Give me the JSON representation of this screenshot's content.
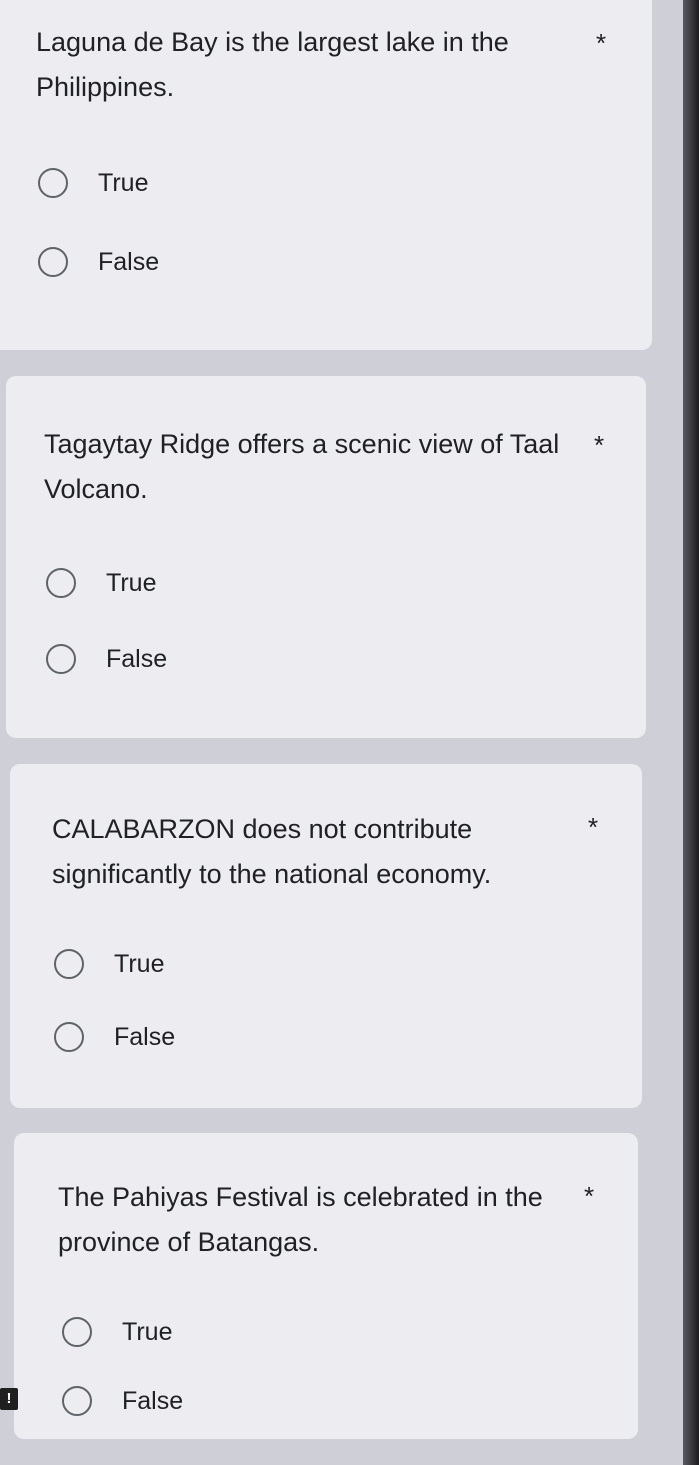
{
  "questions": [
    {
      "text": "Laguna de Bay is the largest lake in the Philippines.",
      "required_mark": "*",
      "options": [
        "True",
        "False"
      ]
    },
    {
      "text": "Tagaytay Ridge offers a scenic view of Taal Volcano.",
      "required_mark": "*",
      "options": [
        "True",
        "False"
      ]
    },
    {
      "text": "CALABARZON does not contribute significantly to the national economy.",
      "required_mark": "*",
      "options": [
        "True",
        "False"
      ]
    },
    {
      "text": "The Pahiyas Festival is celebrated in the province of Batangas.",
      "required_mark": "*",
      "options": [
        "True",
        "False"
      ]
    }
  ],
  "alert_icon_glyph": "!",
  "colors": {
    "card_background": "#ececf1",
    "page_background": "#cfcfd8",
    "radio_border": "#5f6368",
    "text": "#202124"
  }
}
